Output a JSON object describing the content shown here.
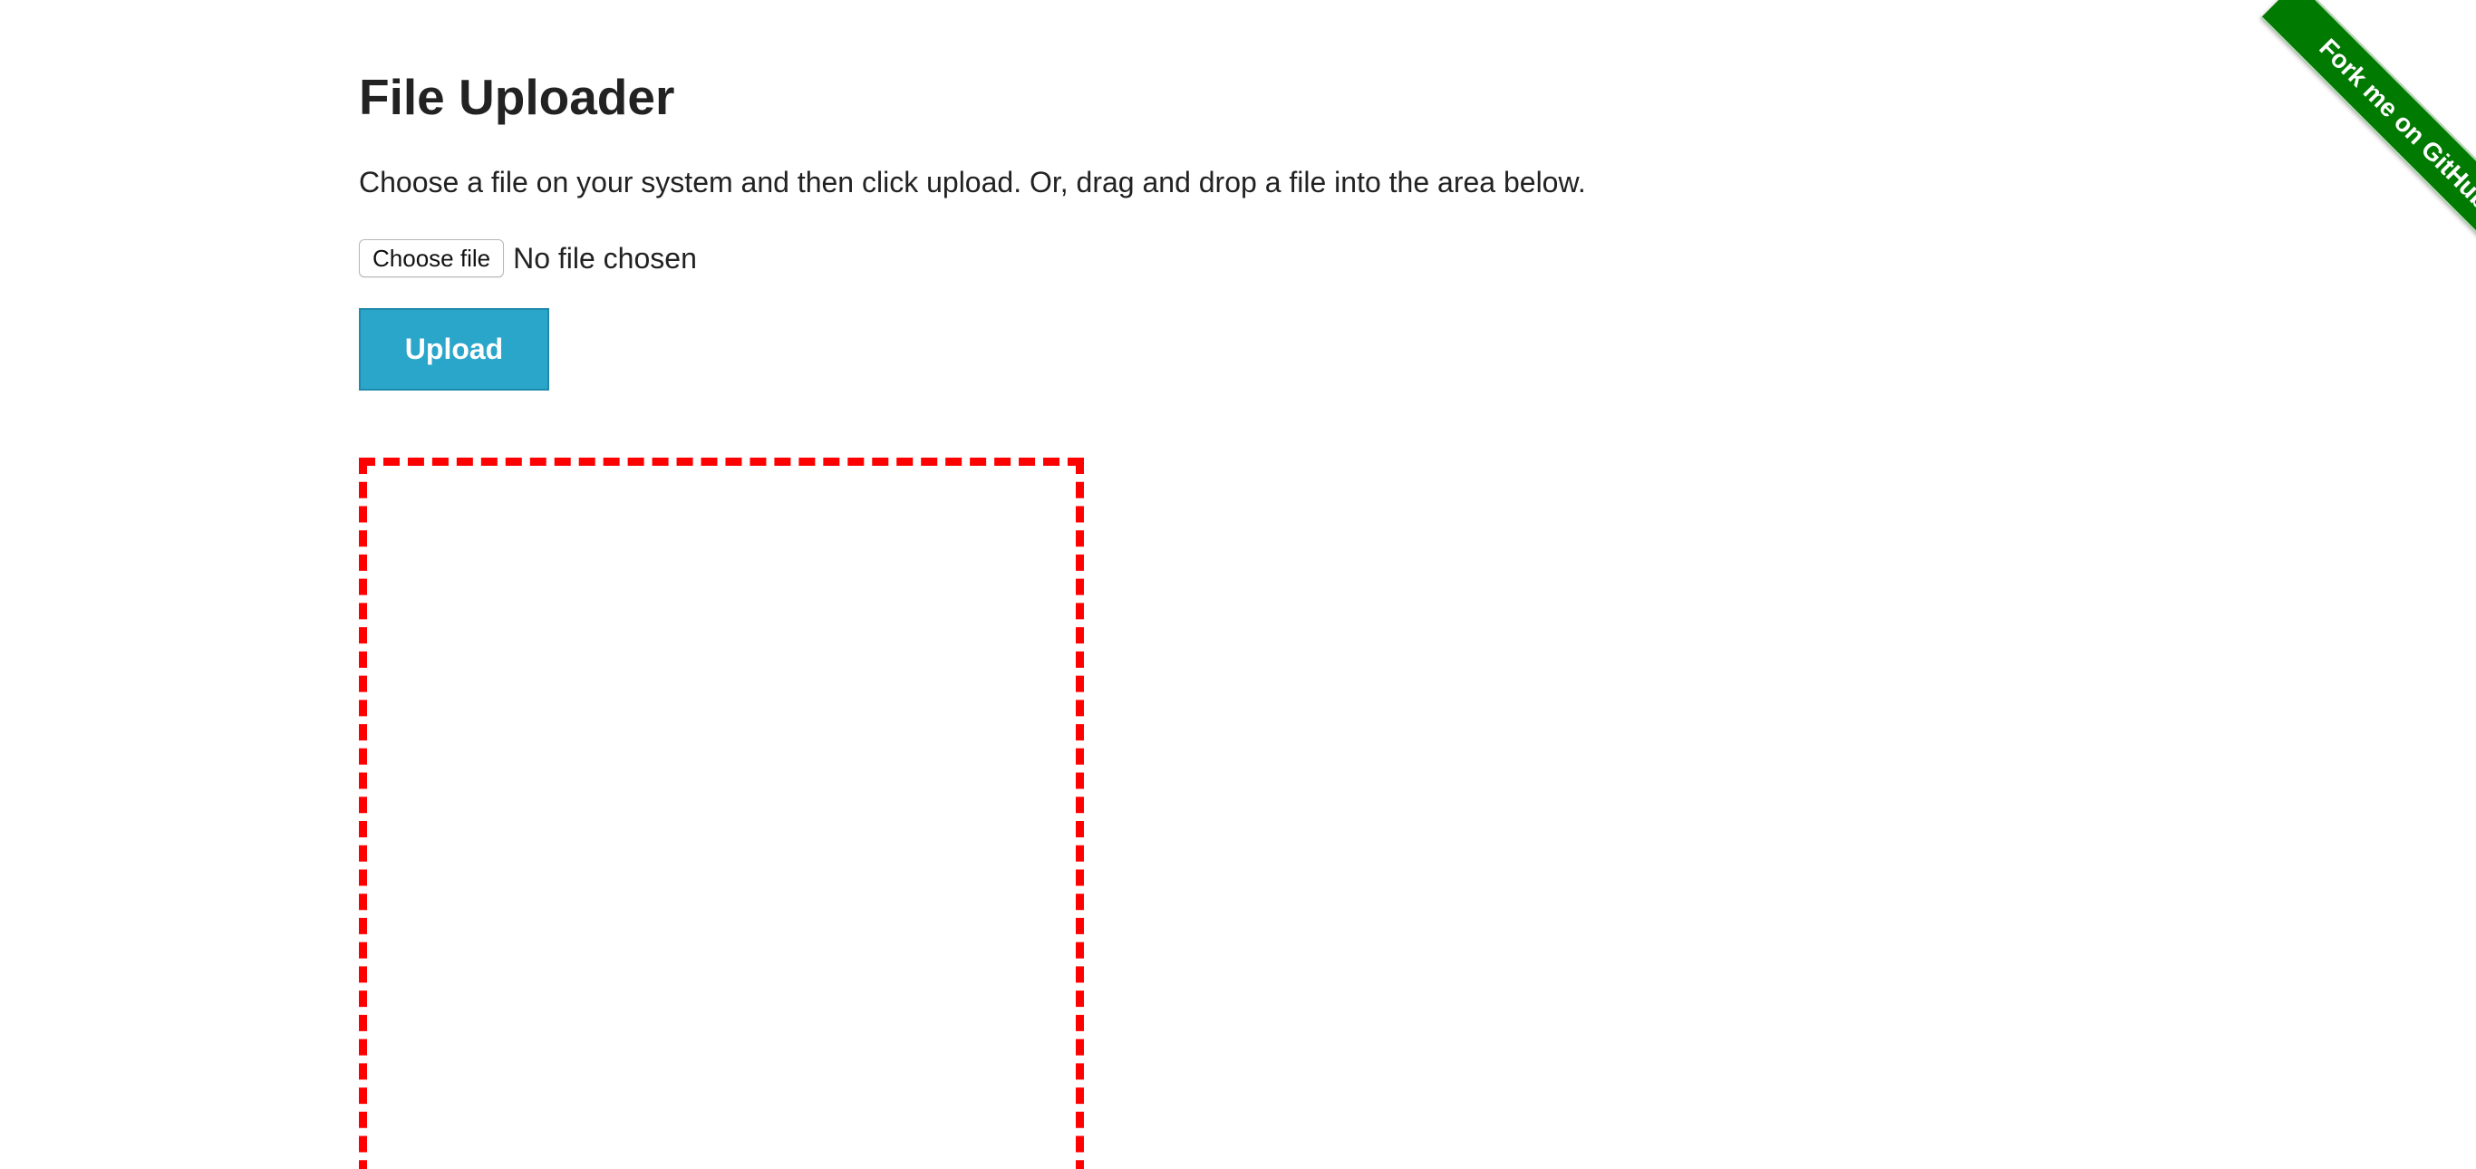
{
  "page": {
    "title": "File Uploader",
    "instructions": "Choose a file on your system and then click upload. Or, drag and drop a file into the area below."
  },
  "file_input": {
    "button_label": "Choose file",
    "status": "No file chosen"
  },
  "actions": {
    "upload_label": "Upload"
  },
  "fork_ribbon": {
    "label": "Fork me on GitHub"
  },
  "colors": {
    "upload_button": "#2ba6cb",
    "drop_zone_border": "#ff0000",
    "ribbon": "#007a00"
  }
}
